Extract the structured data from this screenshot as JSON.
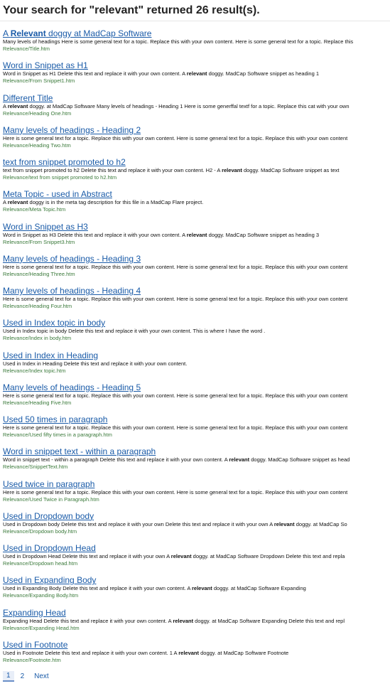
{
  "header": {
    "title": "Your search for \"relevant\" returned 26 result(s)."
  },
  "results": [
    {
      "title": "A Relevant doggy at MadCap Software",
      "title_bold": "Relevant",
      "desc": "Many levels of headings Here is some general text for a topic. Replace this with your own content. Here is some general text for a topic. Replace this",
      "url": "Relevance/Title.htm"
    },
    {
      "title": "Word in Snippet as H1",
      "desc": "Word in Snippet as H1 Delete this text and replace it with your own content. A relevant doggy. MadCap Software snippet as heading 1",
      "url": "Relevance/From Snippet1.htm"
    },
    {
      "title": "Different Title",
      "desc": "A relevant doggy. at MadCap Software Many levels of headings - Heading 1 Here is some generffal textf for a topic. Replace this cat with your own",
      "url": "Relevance/Heading One.htm"
    },
    {
      "title": "Many levels of headings - Heading 2",
      "desc": "Here is some general text for a topic. Replace this with your own content. Here is some general text for a topic. Replace this with your own content",
      "url": "Relevance/Heading Two.htm"
    },
    {
      "title": "text from snippet promoted to h2",
      "desc": "text from snippet promoted to h2 Delete this text and replace it with your own content. H2 - A relevant doggy. MadCap Software snippet as text",
      "url": "Relevance/text from snippet promoted to h2.htm"
    },
    {
      "title": "Meta Topic - used in Abstract",
      "desc": "A relevant doggy is in the meta tag description for this file in a MadCap Flare project.",
      "url": "Relevance/Meta Topic.htm"
    },
    {
      "title": "Word in Snippet as H3",
      "desc": "Word in Snippet as H3 Delete this text and replace it with your own content. A relevant doggy. MadCap Software snippet as heading 3",
      "url": "Relevance/From Snippet3.htm"
    },
    {
      "title": "Many levels of headings - Heading 3",
      "desc": "Here is some general text for a topic. Replace this with your own content. Here is some general text for a topic. Replace this with your own content",
      "url": "Relevance/Heading Three.htm"
    },
    {
      "title": "Many levels of headings - Heading 4",
      "desc": "Here is some general text for a topic. Replace this with your own content. Here is some general text for a topic. Replace this with your own content",
      "url": "Relevance/Heading Four.htm"
    },
    {
      "title": "Used in Index topic in body",
      "desc": "Used in Index topic in body Delete this text and replace it with your own content. This is where I have the word .",
      "url": "Relevance/Index in body.htm"
    },
    {
      "title": "Used in Index in Heading",
      "desc": "Used in Index in Heading Delete this text and replace it with your own content.",
      "url": "Relevance/Index topic.htm"
    },
    {
      "title": "Many levels of headings - Heading 5",
      "desc": "Here is some general text for a topic. Replace this with your own content. Here is some general text for a topic. Replace this with your own content",
      "url": "Relevance/Heading Five.htm"
    },
    {
      "title": "Used 50 times in paragraph",
      "desc": "Here is some general text for a topic. Replace this with your own content. Here is some general text for a topic. Replace this with your own content",
      "url": "Relevance/Used fifty times in a paragraph.htm"
    },
    {
      "title": "Word in snippet text - within a paragraph",
      "desc": "Word in snippet text - within a paragraph Delete this text and replace it with your own content. A relevant doggy. MadCap Software snippet as head",
      "url": "Relevance/SnippetText.htm"
    },
    {
      "title": "Used twice in paragraph",
      "desc": "Here is some general text for a topic. Replace this with your own content. Here is some general text for a topic. Replace this with your own content",
      "url": "Relevance/Used Twice in Paragraph.htm"
    },
    {
      "title": "Used in Dropdown body",
      "desc": "Used in Dropdown body Delete this text and replace it with your own Delete this text and replace it with your own A relevant doggy. at MadCap So",
      "url": "Relevance/Dropdown body.htm"
    },
    {
      "title": "Used in Dropdown Head",
      "desc": "Used in Dropdown Head Delete this text and replace it with your own A relevant doggy. at MadCap Software Dropdown Delete this text and repla",
      "url": "Relevance/Dropdown head.htm"
    },
    {
      "title": "Used in Expanding Body",
      "desc": "Used in Expanding Body Delete this text and replace it with your own content. A relevant doggy. at MadCap Software Expanding",
      "url": "Relevance/Expanding Body.htm"
    },
    {
      "title": "Expanding Head",
      "desc": "Expanding Head Delete this text and replace it with your own content. A relevant doggy. at MadCap Software Expanding Delete this text and repl",
      "url": "Relevance/Expanding Head.htm"
    },
    {
      "title": "Used in Footnote",
      "desc": "Used in Footnote Delete this text and replace it with your own content. 1 A relevant doggy. at MadCap Software Footnote",
      "url": "Relevance/Footnote.htm"
    }
  ],
  "highlight_word": "relevant",
  "pager": {
    "page1": "1",
    "page2": "2",
    "next": "Next"
  },
  "colors": {
    "link": "#1a5ba8",
    "url": "#3b7a3b",
    "current_page_bg": "#e8eef8"
  }
}
